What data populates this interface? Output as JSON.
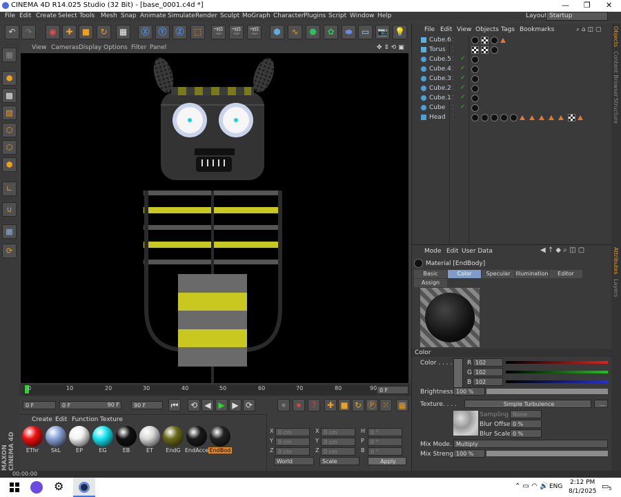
{
  "window": {
    "title": "CINEMA 4D R14.025 Studio (32 Bit) - [base_0001.c4d *]",
    "min": "—",
    "restore": "❐",
    "close": "✕"
  },
  "menu": [
    "File",
    "Edit",
    "Create",
    "Select",
    "Tools",
    "Mesh",
    "Snap",
    "Animate",
    "Simulate",
    "Render",
    "Sculpt",
    "MoGraph",
    "Character",
    "Plugins",
    "Script",
    "Window",
    "Help"
  ],
  "layout": {
    "label": "Layout:",
    "value": "Startup"
  },
  "viewport_menu": [
    "View",
    "Cameras",
    "Display",
    "Options",
    "Filter",
    "Panel"
  ],
  "timeline": {
    "ticks": [
      "0",
      "10",
      "20",
      "30",
      "40",
      "50",
      "60",
      "70",
      "80",
      "90"
    ],
    "frame_field": "0 F",
    "start": "0 F",
    "min": "0 F",
    "max": "90 F",
    "end": "90 F"
  },
  "material_manager": {
    "menu": [
      "Create",
      "Edit",
      "Function",
      "Texture"
    ],
    "materials": [
      {
        "name": "EThr",
        "color": "#f01010"
      },
      {
        "name": "SkL",
        "color": "#8aa4d8"
      },
      {
        "name": "EP",
        "color": "#f2f2f2"
      },
      {
        "name": "EG",
        "color": "#18e6f0"
      },
      {
        "name": "EB",
        "color": "#111111"
      },
      {
        "name": "ET",
        "color": "#d8d8d8"
      },
      {
        "name": "EndG",
        "color": "#6b6b1a"
      },
      {
        "name": "EndAcce",
        "color": "#1a1a1a"
      },
      {
        "name": "EndBod",
        "color": "#222222"
      }
    ]
  },
  "coords": {
    "rows": [
      {
        "a": "X",
        "v1": "0 cm",
        "b": "X",
        "v2": "0 cm",
        "c": "H",
        "v3": "0 °"
      },
      {
        "a": "Y",
        "v1": "0 cm",
        "b": "Y",
        "v2": "0 cm",
        "c": "P",
        "v3": "0 °"
      },
      {
        "a": "Z",
        "v1": "0 cm",
        "b": "Z",
        "v2": "0 cm",
        "c": "B",
        "v3": "0 °"
      }
    ],
    "mode": "World",
    "scale": "Scale",
    "apply": "Apply"
  },
  "object_manager": {
    "menu": [
      "File",
      "Edit",
      "View",
      "Objects",
      "Tags",
      "Bookmarks"
    ],
    "objects": [
      {
        "name": "Cube.6"
      },
      {
        "name": "Torus"
      },
      {
        "name": "Cube.5"
      },
      {
        "name": "Cube.4"
      },
      {
        "name": "Cube.3"
      },
      {
        "name": "Cube.2"
      },
      {
        "name": "Cube.1"
      },
      {
        "name": "Cube"
      },
      {
        "name": "Head"
      }
    ]
  },
  "attributes": {
    "menu": [
      "Mode",
      "Edit",
      "User Data"
    ],
    "material_title": "Material [EndBody]",
    "tabs": [
      "Basic",
      "Color",
      "Specular",
      "Illumination",
      "Editor",
      "Assign"
    ],
    "section": "Color",
    "color_label": "Color . . . .",
    "r_label": "R",
    "r": "102",
    "g_label": "G",
    "g": "102",
    "b_label": "B",
    "b": "102",
    "brightness_label": "Brightness . .",
    "brightness": "100 %",
    "texture_label": "Texture. . . .",
    "texture_name": "Simple Turbulence",
    "texture_more": "...",
    "sampling_label": "Sampling",
    "sampling": "None",
    "blur_offset_label": "Blur Offset",
    "blur_offset": "0 %",
    "blur_scale_label": "Blur Scale",
    "blur_scale": "0 %",
    "mix_mode_label": "Mix Mode. . . .",
    "mix_mode": "Multiply",
    "mix_strength_label": "Mix Strength",
    "mix_strength": "100 %"
  },
  "right_tabs": [
    "Objects",
    "Content Browser",
    "Structure"
  ],
  "right_tabs2": [
    "Attributes",
    "Layers"
  ],
  "status": {
    "time": "00:00:00"
  },
  "taskbar": {
    "lang": "ENG",
    "time": "2:12 PM",
    "date": "8/1/2025",
    "notif": "5"
  }
}
